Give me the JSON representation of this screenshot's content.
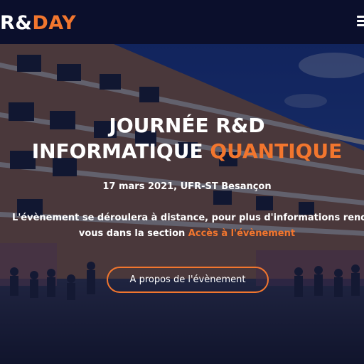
{
  "brand": {
    "logo_part1": "R&",
    "logo_part2": "DAY"
  },
  "hero": {
    "title_line1": "JOURNÉE R&D",
    "title_line2_start": "INFORMATIQUE ",
    "title_line2_accent": "QUANTIQUE",
    "date": "17 mars 2021, UFR-ST Besançon",
    "notice_line1": "L'évènement se déroulera à distance, pour plus d'informations rendez",
    "notice_line2_start": "vous dans la section ",
    "notice_link": "Accès à l'évènement",
    "button_label": "A propos de l'évènement"
  },
  "icons": {
    "menu": "hamburger-menu-icon"
  },
  "colors": {
    "accent": "#f2762e",
    "navbar": "#0b0f2c"
  }
}
